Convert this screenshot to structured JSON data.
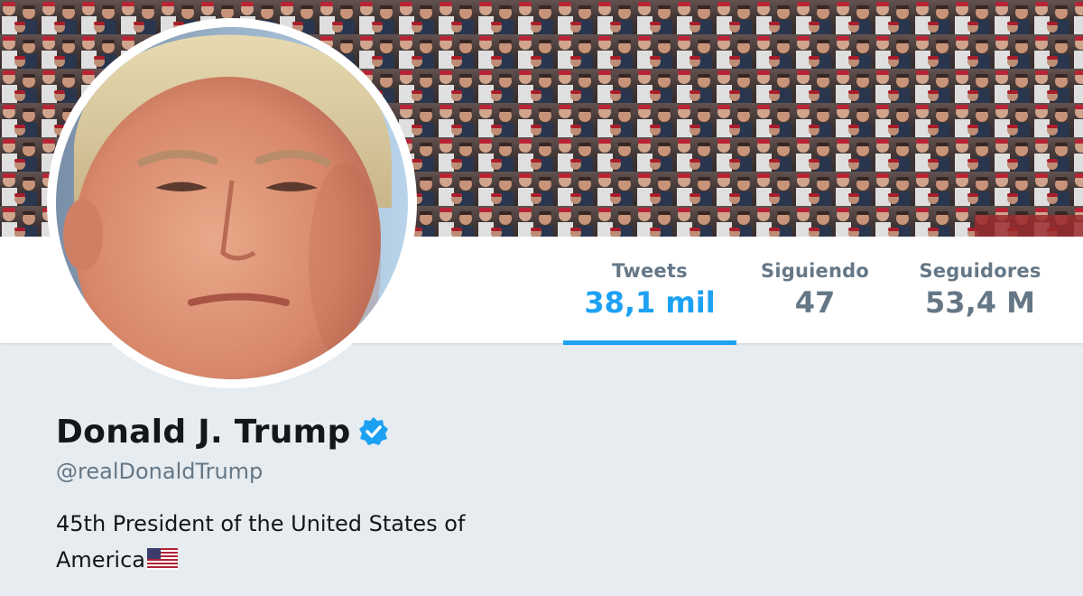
{
  "profile": {
    "name": "Donald J. Trump",
    "handle": "@realDonaldTrump",
    "bio": "45th President of the United States of America",
    "bio_flag_icon": "us-flag-icon",
    "verified_icon": "verified-badge-icon"
  },
  "stats": {
    "tweets": {
      "label": "Tweets",
      "value": "38,1 mil"
    },
    "following": {
      "label": "Siguiendo",
      "value": "47"
    },
    "followers": {
      "label": "Seguidores",
      "value": "53,4 M"
    }
  },
  "colors": {
    "accent": "#1da1f2",
    "muted_text": "#657786",
    "primary_text": "#14171a",
    "page_background": "#e6ecf0"
  }
}
